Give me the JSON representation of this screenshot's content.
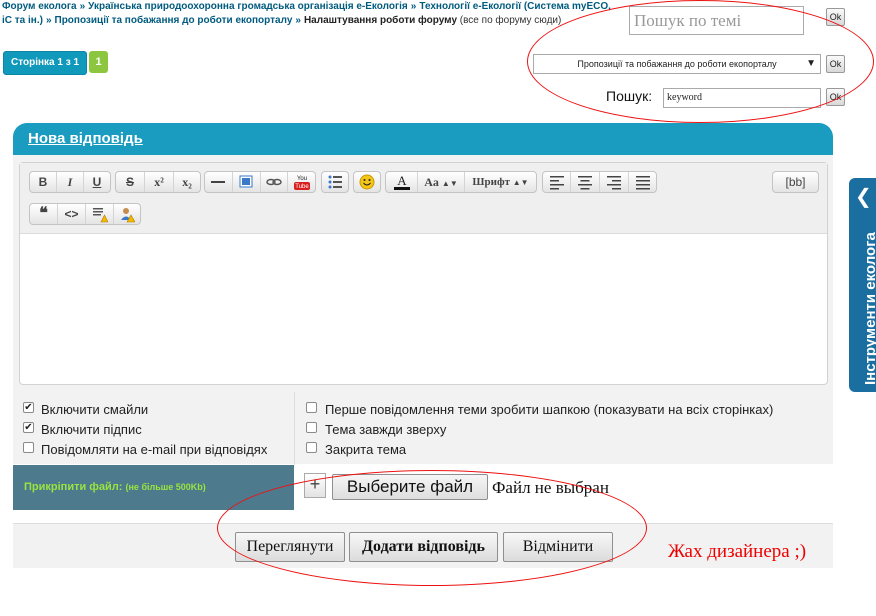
{
  "breadcrumb": {
    "items": [
      "Форум еколога",
      "Українська природоохоронна громадська організація e-Екологія",
      "Технології e-Екології (Система myECO, iC та ін.)",
      "Пропозиції та побажання до роботи екопорталу"
    ],
    "current": "Налаштування роботи форуму",
    "note": "(все по форуму сюди)"
  },
  "pagination": {
    "label": "Сторінка 1 з 1",
    "current": "1"
  },
  "topic_search": {
    "placeholder": "Пошук по темі",
    "ok": "Ok"
  },
  "forum_select": {
    "value": "Пропозиції та побажання до роботи екопорталу",
    "ok": "Ok"
  },
  "search": {
    "label": "Пошук:",
    "value": "keyword",
    "ok": "Ok"
  },
  "reply": {
    "title": "Нова відповідь"
  },
  "toolbar": {
    "bold": "B",
    "italic": "I",
    "underline": "U",
    "strike": "S",
    "sup": "x²",
    "sub": "x₂",
    "font_size": "Aa",
    "font_name": "Шрифт",
    "bbcode": "[bb]",
    "youtube": "You Tube"
  },
  "options_left": [
    {
      "label": "Включити смайли",
      "checked": true
    },
    {
      "label": "Включити підпис",
      "checked": true
    },
    {
      "label": "Повідомляти на e-mail при відповідях",
      "checked": false
    }
  ],
  "options_right": [
    {
      "label": "Перше повідомлення теми зробити шапкою (показувати на всіх сторінках)",
      "checked": false
    },
    {
      "label": "Тема завжди зверху",
      "checked": false
    },
    {
      "label": "Закрита тема",
      "checked": false
    }
  ],
  "attach": {
    "label": "Прикріпити файл:",
    "limit": "(не більше 500Kb)",
    "plus": "+",
    "choose": "Выберите файл",
    "status": "Файл не выбран"
  },
  "actions": {
    "preview": "Переглянути",
    "submit": "Додати відповідь",
    "cancel": "Відмінити"
  },
  "comment": "Жах дизайнера ;)",
  "side_tab": {
    "label": "Інструменти еколога"
  },
  "colors": {
    "header_teal": "#1a9cc0",
    "attach_bg": "#4e7a8e",
    "attach_text": "#9be33f",
    "annotation": "#e00000",
    "side_tab": "#1b6ea0"
  }
}
